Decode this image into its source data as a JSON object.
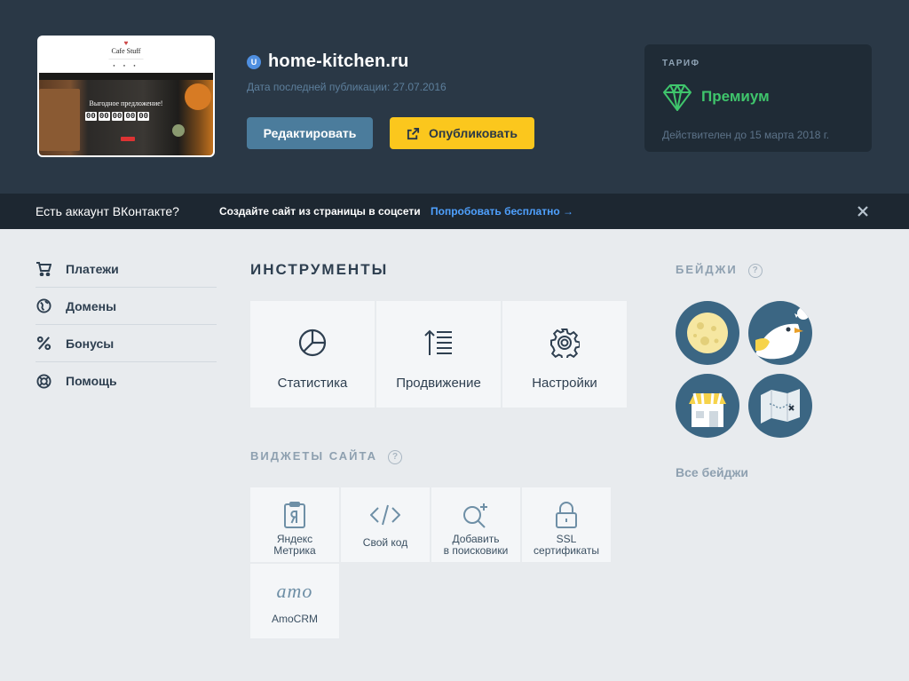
{
  "site": {
    "badge_letter": "U",
    "name": "home-kitchen.ru",
    "last_publish": "Дата последней публикации: 27.07.2016",
    "edit_label": "Редактировать",
    "publish_label": "Опубликовать",
    "preview": {
      "title": "Cafe Stuff",
      "caption": "Выгодное предложение!",
      "timer": [
        "00",
        "00",
        "00",
        "00",
        "00"
      ]
    }
  },
  "tariff": {
    "label": "ТАРИФ",
    "name": "Премиум",
    "valid_until": "Действителен до 15 марта 2018 г.",
    "color": "#3fc56c"
  },
  "promo": {
    "question": "Есть аккаунт ВКонтакте?",
    "text": "Создайте сайт из страницы в соцсети",
    "link": "Попробовать бесплатно →"
  },
  "sidebar": {
    "items": [
      {
        "label": "Платежи",
        "icon": "cart-icon"
      },
      {
        "label": "Домены",
        "icon": "globe-icon"
      },
      {
        "label": "Бонусы",
        "icon": "percent-icon"
      },
      {
        "label": "Помощь",
        "icon": "lifebuoy-icon"
      }
    ]
  },
  "tools": {
    "title": "ИНСТРУМЕНТЫ",
    "items": [
      {
        "label": "Статистика",
        "icon": "pie-chart-icon"
      },
      {
        "label": "Продвижение",
        "icon": "sort-list-icon"
      },
      {
        "label": "Настройки",
        "icon": "gear-icon"
      }
    ]
  },
  "widgets": {
    "title": "ВИДЖЕТЫ САЙТА",
    "help": "?",
    "items": [
      {
        "label": "Яндекс\nМетрика",
        "icon": "yandex-metrika-icon"
      },
      {
        "label": "Свой код",
        "icon": "code-icon"
      },
      {
        "label": "Добавить\nв поисковики",
        "icon": "search-plus-icon"
      },
      {
        "label": "SSL\nсертификаты",
        "icon": "lock-icon"
      },
      {
        "label": "AmoCRM",
        "icon": "amo-logo",
        "logo_text": "amo"
      }
    ]
  },
  "badges": {
    "title": "БЕЙДЖИ",
    "help": "?",
    "items": [
      {
        "name": "moon-badge"
      },
      {
        "name": "bird-badge"
      },
      {
        "name": "shop-badge"
      },
      {
        "name": "map-badge"
      }
    ],
    "all_label": "Все бейджи"
  }
}
